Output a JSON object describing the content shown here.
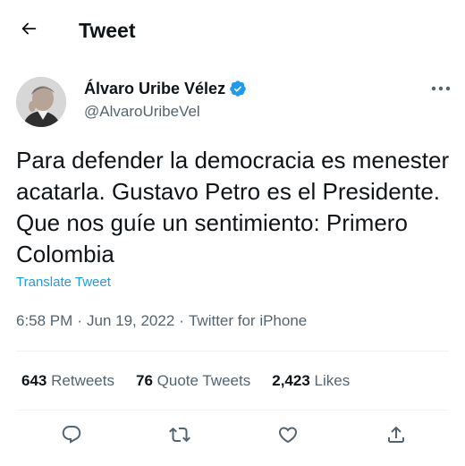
{
  "header": {
    "title": "Tweet",
    "back_icon": "arrow-left-icon"
  },
  "author": {
    "name": "Álvaro Uribe Vélez",
    "handle": "@AlvaroUribeVel",
    "verified_color": "#1d9bf0"
  },
  "tweet": {
    "text": "Para defender la democracia es menester acatarla. Gustavo Petro es el Presidente. Que nos guíe un sentimiento: Primero Colombia",
    "translate_label": "Translate Tweet",
    "time": "6:58 PM",
    "separator": "·",
    "date": "Jun 19, 2022",
    "source": "Twitter for iPhone"
  },
  "stats": {
    "retweets": {
      "count": "643",
      "label": "Retweets"
    },
    "quotes": {
      "count": "76",
      "label": "Quote Tweets"
    },
    "likes": {
      "count": "2,423",
      "label": "Likes"
    }
  },
  "actions": [
    "reply-icon",
    "retweet-icon",
    "like-icon",
    "share-icon"
  ],
  "colors": {
    "accent": "#1d9bf0",
    "text_primary": "#0f1419",
    "text_secondary": "#536471",
    "divider": "#eff3f4"
  }
}
